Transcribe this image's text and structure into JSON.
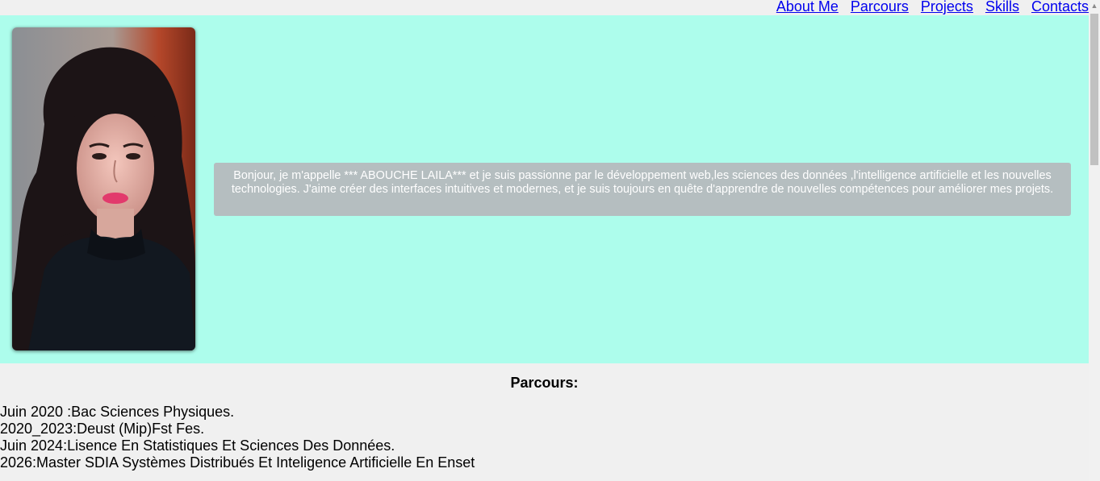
{
  "nav": {
    "items": [
      {
        "label": "About Me"
      },
      {
        "label": "Parcours"
      },
      {
        "label": "Projects"
      },
      {
        "label": "Skills"
      },
      {
        "label": "Contacts"
      }
    ]
  },
  "hero": {
    "background": "#adfdec",
    "bio": "Bonjour, je m'appelle *** ABOUCHE LAILA*** et je suis passionne par le développement web,les sciences des données ,l'intelligence artificielle et les nouvelles technologies. J'aime créer des interfaces intuitives et modernes, et je suis toujours en quête d'apprendre de nouvelles compétences pour améliorer mes projets."
  },
  "parcours": {
    "title": "Parcours:",
    "items": [
      "Juin 2020 :Bac Sciences Physiques.",
      "2020_2023:Deust (Mip)Fst Fes.",
      "Juin 2024:Lisence En Statistiques Et Sciences Des Données.",
      "2026:Master SDIA Systèmes Distribués Et Inteligence Artificielle En Enset"
    ]
  },
  "colors": {
    "link": "#0000ee",
    "bio_box": "#b5bec0",
    "page_bg": "#f0f0f0"
  }
}
